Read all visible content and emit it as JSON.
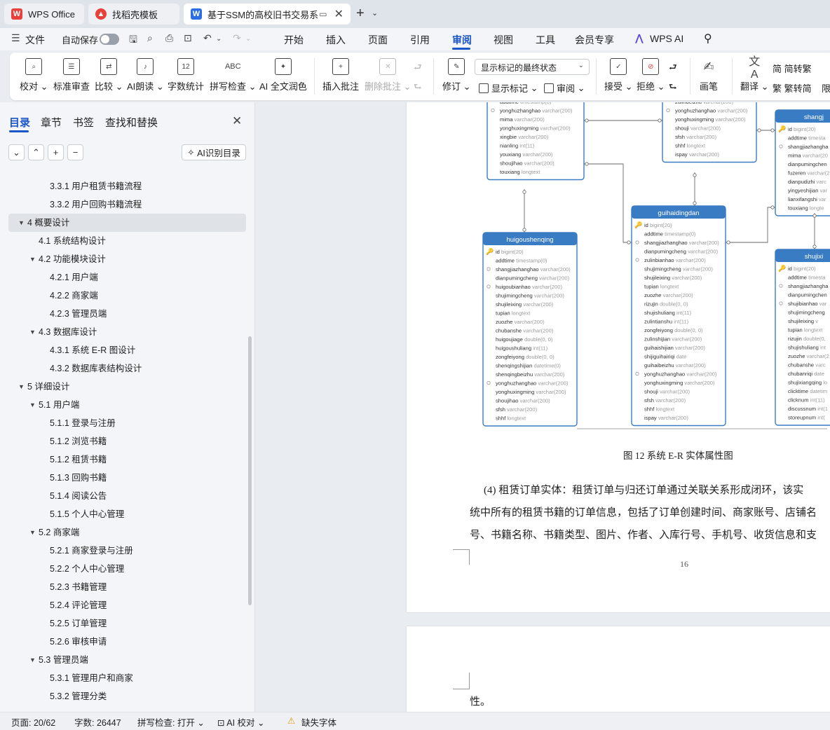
{
  "tabs": [
    {
      "label": "WPS Office"
    },
    {
      "label": "找稻壳模板"
    },
    {
      "label": "基于SSM的高校旧书交易系统"
    }
  ],
  "menu": {
    "file": "文件",
    "autosave": "自动保存",
    "items": [
      "开始",
      "插入",
      "页面",
      "引用",
      "审阅",
      "视图",
      "工具",
      "会员专享"
    ],
    "active": "审阅",
    "wps_ai": "WPS AI"
  },
  "ribbon": {
    "proofread": "校对",
    "std_review": "标准审查",
    "compare": "比较",
    "ai_read": "AI朗读",
    "word_count": "字数统计",
    "spell_check": "拼写检查",
    "ai_polish": "AI 全文润色",
    "insert_comment": "插入批注",
    "delete_comment": "删除批注",
    "revise": "修订",
    "markup_state": "显示标记的最终状态",
    "show_markup": "显示标记",
    "review": "审阅",
    "accept": "接受",
    "reject": "拒绝",
    "pen": "画笔",
    "translate": "翻译",
    "to_trad": "简转繁",
    "to_simp": "繁转简",
    "restrict": "限"
  },
  "panel": {
    "tabs": [
      "目录",
      "章节",
      "书签",
      "查找和替换"
    ],
    "active_tab": "目录",
    "ai_toc": "AI识别目录",
    "toc": [
      {
        "level": 3,
        "num": "3.3.1",
        "text": "用户租赁书籍流程",
        "toggle": ""
      },
      {
        "level": 3,
        "num": "3.3.2",
        "text": "用户回购书籍流程",
        "toggle": ""
      },
      {
        "level": 1,
        "num": "4",
        "text": "概要设计",
        "toggle": "▲",
        "selected": true
      },
      {
        "level": 2,
        "num": "4.1",
        "text": "系统结构设计",
        "toggle": ""
      },
      {
        "level": 2,
        "num": "4.2",
        "text": "功能模块设计",
        "toggle": "▼"
      },
      {
        "level": 3,
        "num": "4.2.1",
        "text": "用户端",
        "toggle": ""
      },
      {
        "level": 3,
        "num": "4.2.2",
        "text": "商家端",
        "toggle": ""
      },
      {
        "level": 3,
        "num": "4.2.3",
        "text": "管理员端",
        "toggle": ""
      },
      {
        "level": 2,
        "num": "4.3",
        "text": "数据库设计",
        "toggle": "▼"
      },
      {
        "level": 3,
        "num": "4.3.1",
        "text": "系统 E-R 图设计",
        "toggle": ""
      },
      {
        "level": 3,
        "num": "4.3.2",
        "text": "数据库表结构设计",
        "toggle": ""
      },
      {
        "level": 1,
        "num": "5",
        "text": "详细设计",
        "toggle": "▼"
      },
      {
        "level": 2,
        "num": "5.1",
        "text": "用户端",
        "toggle": "▼"
      },
      {
        "level": 3,
        "num": "5.1.1",
        "text": "登录与注册",
        "toggle": ""
      },
      {
        "level": 3,
        "num": "5.1.2",
        "text": "浏览书籍",
        "toggle": ""
      },
      {
        "level": 3,
        "num": "5.1.2",
        "text": "租赁书籍",
        "toggle": ""
      },
      {
        "level": 3,
        "num": "5.1.3",
        "text": "回购书籍",
        "toggle": ""
      },
      {
        "level": 3,
        "num": "5.1.4",
        "text": "阅读公告",
        "toggle": ""
      },
      {
        "level": 3,
        "num": "5.1.5",
        "text": "个人中心管理",
        "toggle": ""
      },
      {
        "level": 2,
        "num": "5.2",
        "text": "商家端",
        "toggle": "▼"
      },
      {
        "level": 3,
        "num": "5.2.1",
        "text": "商家登录与注册",
        "toggle": ""
      },
      {
        "level": 3,
        "num": "5.2.2",
        "text": "个人中心管理",
        "toggle": ""
      },
      {
        "level": 3,
        "num": "5.2.3",
        "text": "书籍管理",
        "toggle": ""
      },
      {
        "level": 3,
        "num": "5.2.4",
        "text": "评论管理",
        "toggle": ""
      },
      {
        "level": 3,
        "num": "5.2.5",
        "text": "订单管理",
        "toggle": ""
      },
      {
        "level": 3,
        "num": "5.2.6",
        "text": "审核申请",
        "toggle": ""
      },
      {
        "level": 2,
        "num": "5.3",
        "text": "管理员端",
        "toggle": "▼"
      },
      {
        "level": 3,
        "num": "5.3.1",
        "text": "管理用户和商家",
        "toggle": ""
      },
      {
        "level": 3,
        "num": "5.3.2",
        "text": "管理分类",
        "toggle": ""
      }
    ]
  },
  "document": {
    "er_tables": [
      {
        "name": "",
        "fields": [
          [
            "addtime",
            "timestamp(0)"
          ],
          [
            "yonghuzhanghao",
            "varchar(200)"
          ],
          [
            "mima",
            "varchar(200)"
          ],
          [
            "yonghuxingming",
            "varchar(200)"
          ],
          [
            "xingbie",
            "varchar(200)"
          ],
          [
            "nianling",
            "int(11)"
          ],
          [
            "youxiang",
            "varchar(200)"
          ],
          [
            "shoujihao",
            "varchar(200)"
          ],
          [
            "touxiang",
            "longtext"
          ]
        ]
      },
      {
        "name": "",
        "fields": [
          [
            "zulinbeizhu",
            "varchar(200)"
          ],
          [
            "yonghuzhanghao",
            "varchar(200)"
          ],
          [
            "yonghuxingming",
            "varchar(200)"
          ],
          [
            "shouji",
            "varchar(200)"
          ],
          [
            "sfsh",
            "varchar(200)"
          ],
          [
            "shhf",
            "longtext"
          ],
          [
            "ispay",
            "varchar(200)"
          ]
        ]
      },
      {
        "name": "shangj",
        "fields": [
          [
            "id",
            "bigint(20)"
          ],
          [
            "addtime",
            "timesta"
          ],
          [
            "shangjiazhangha",
            ""
          ],
          [
            "mima",
            "varchar(20"
          ],
          [
            "dianpumingchen",
            ""
          ],
          [
            "fuzeren",
            "varchar(2"
          ],
          [
            "dianpudizhi",
            "varc"
          ],
          [
            "yingyeshijian",
            "var"
          ],
          [
            "lianxifangshi",
            "var"
          ],
          [
            "touxiang",
            "longte"
          ]
        ]
      },
      {
        "name": "guihaidingdan",
        "fields": [
          [
            "id",
            "bigint(20)"
          ],
          [
            "addtime",
            "timestamp(0)"
          ],
          [
            "shangjiazhanghao",
            "varchar(200)"
          ],
          [
            "dianpumingcheng",
            "varchar(200)"
          ],
          [
            "zulinbianhao",
            "varchar(200)"
          ],
          [
            "shujimingcheng",
            "varchar(200)"
          ],
          [
            "shujileixing",
            "varchar(200)"
          ],
          [
            "tupian",
            "longtext"
          ],
          [
            "zuozhe",
            "varchar(200)"
          ],
          [
            "rizujin",
            "double(0, 0)"
          ],
          [
            "shujishuliang",
            "int(11)"
          ],
          [
            "zulintianshu",
            "int(11)"
          ],
          [
            "zongfeiyong",
            "double(0, 0)"
          ],
          [
            "zulinshijian",
            "varchar(200)"
          ],
          [
            "guihaishijian",
            "varchar(200)"
          ],
          [
            "shijiguihairiqi",
            "date"
          ],
          [
            "guihaibeizhu",
            "varchar(200)"
          ],
          [
            "yonghuzhanghao",
            "varchar(200)"
          ],
          [
            "yonghuxingming",
            "varchar(200)"
          ],
          [
            "shouji",
            "varchar(200)"
          ],
          [
            "sfsh",
            "varchar(200)"
          ],
          [
            "shhf",
            "longtext"
          ],
          [
            "ispay",
            "varchar(200)"
          ]
        ]
      },
      {
        "name": "huigoushenqing",
        "fields": [
          [
            "id",
            "bigint(20)"
          ],
          [
            "addtime",
            "timestamp(0)"
          ],
          [
            "shangjiazhanghao",
            "varchar(200)"
          ],
          [
            "dianpumingcheng",
            "varchar(200)"
          ],
          [
            "huigoubianhao",
            "varchar(200)"
          ],
          [
            "shujimingcheng",
            "varchar(200)"
          ],
          [
            "shujileixing",
            "varchar(200)"
          ],
          [
            "tupian",
            "longtext"
          ],
          [
            "zuozhe",
            "varchar(200)"
          ],
          [
            "chubanshe",
            "varchar(200)"
          ],
          [
            "huigoujiage",
            "double(0, 0)"
          ],
          [
            "huigoushuliang",
            "int(11)"
          ],
          [
            "zongfeiyong",
            "double(0, 0)"
          ],
          [
            "shenqingshijian",
            "datetime(0)"
          ],
          [
            "shenqingbeizhu",
            "varchar(200)"
          ],
          [
            "yonghuzhanghao",
            "varchar(200)"
          ],
          [
            "yonghuxingming",
            "varchar(200)"
          ],
          [
            "shoujihao",
            "varchar(200)"
          ],
          [
            "sfsh",
            "varchar(200)"
          ],
          [
            "shhf",
            "longtext"
          ]
        ]
      },
      {
        "name": "shujixi",
        "fields": [
          [
            "id",
            "bigint(20)"
          ],
          [
            "addtime",
            "timesta"
          ],
          [
            "shangjiazhangha",
            ""
          ],
          [
            "dianpumingchen",
            ""
          ],
          [
            "shujibianhao",
            "var"
          ],
          [
            "shujimingcheng",
            ""
          ],
          [
            "shujileixing",
            "v"
          ],
          [
            "tupian",
            "longtext"
          ],
          [
            "rizujin",
            "double(0,"
          ],
          [
            "shujishuliang",
            "int"
          ],
          [
            "zuozhe",
            "varchar(2"
          ],
          [
            "chubanshe",
            "varc"
          ],
          [
            "chubanriqi",
            "date"
          ],
          [
            "shujixiangqing",
            "lo"
          ],
          [
            "clicktime",
            "datetim"
          ],
          [
            "clicknum",
            "int(11)"
          ],
          [
            "discussnum",
            "int(1"
          ],
          [
            "storeupnum",
            "int("
          ]
        ]
      }
    ],
    "caption": "图 12  系统 E-R 实体属性图",
    "paragraph": [
      "(4) 租赁订单实体：租赁订单与归还订单通过关联关系形成闭环，该实",
      "统中所有的租赁书籍的订单信息，包括了订单创建时间、商家账号、店铺名",
      "号、书籍名称、书籍类型、图片、作者、入库行号、手机号、收货信息和支"
    ],
    "page_number": "16",
    "page2_text": "性。"
  },
  "status": {
    "page": "页面: 20/62",
    "words": "字数: 26447",
    "spell": "拼写检查: 打开",
    "ai_proof": "AI 校对",
    "missing_font": "缺失字体"
  },
  "colors": {
    "accent": "#1a56c7",
    "er_header": "#3a7cc4",
    "er_border": "#3a7cc4",
    "key_icon": "#d9a400"
  }
}
